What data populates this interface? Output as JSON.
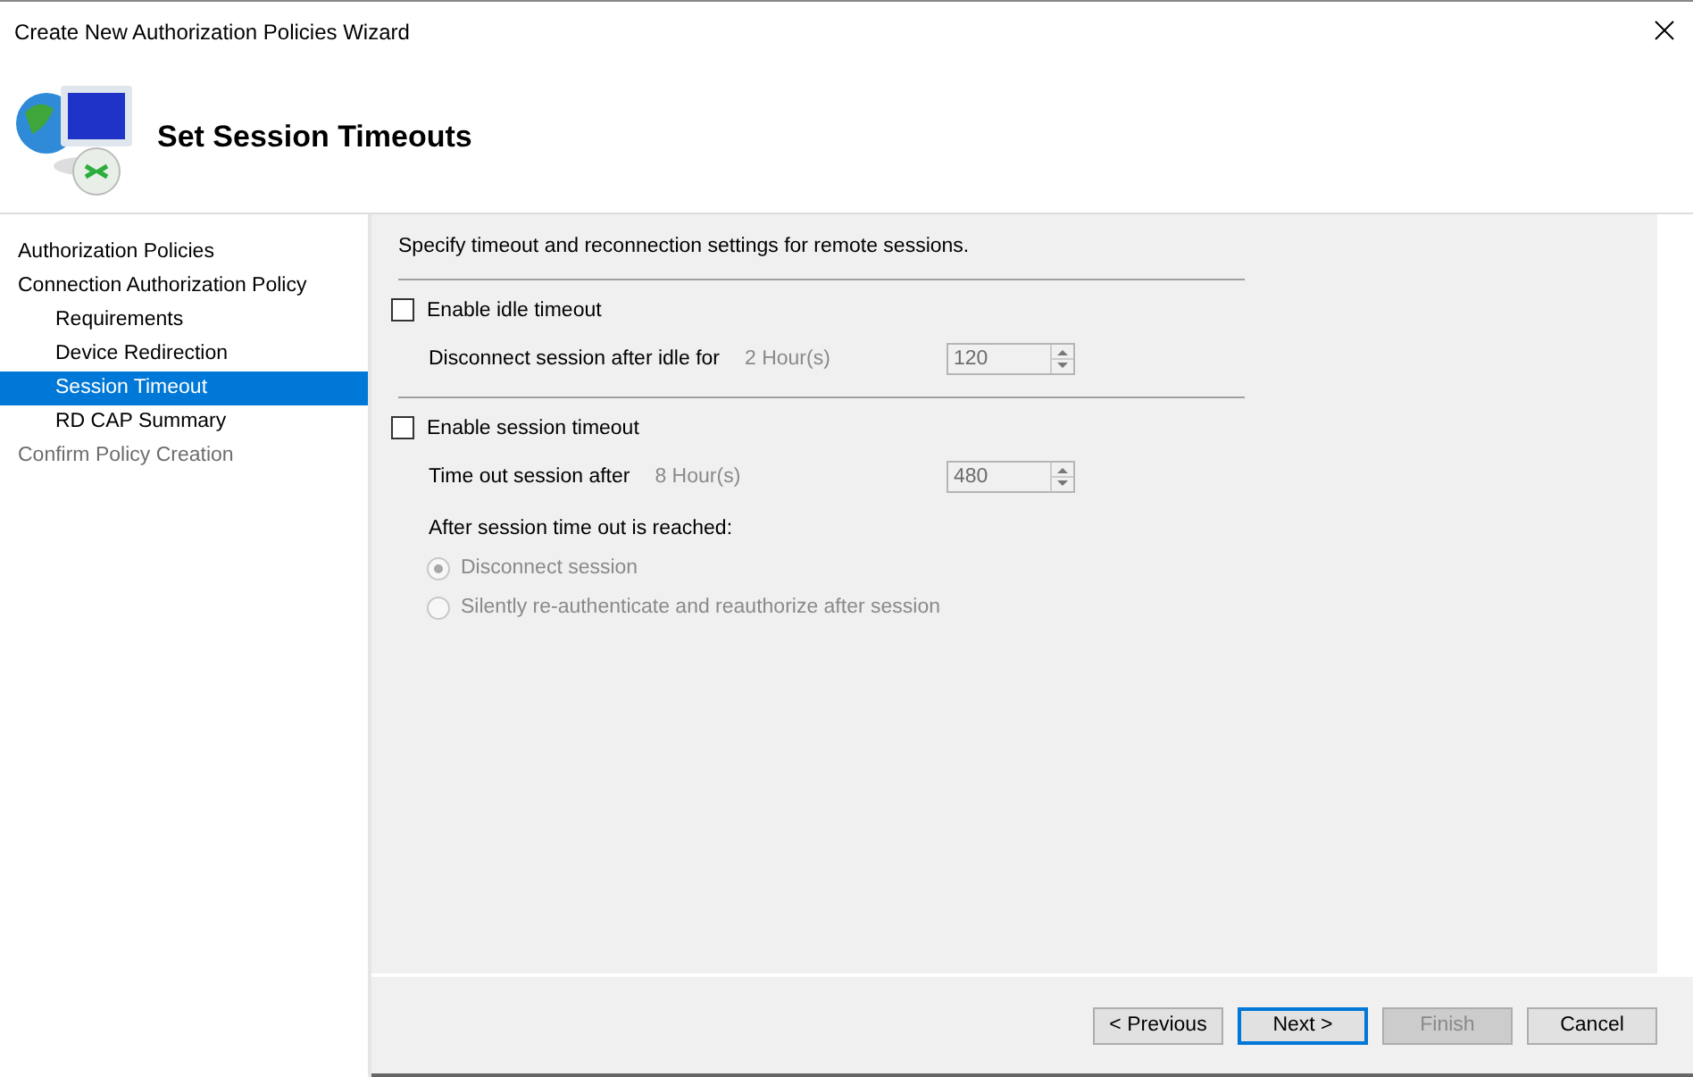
{
  "window": {
    "title": "Create New Authorization Policies Wizard"
  },
  "header": {
    "title": "Set Session Timeouts"
  },
  "sidebar": {
    "items": [
      {
        "label": "Authorization Policies",
        "selected": false,
        "disabled": false
      },
      {
        "label": "Connection Authorization Policy",
        "selected": false,
        "disabled": false,
        "children": [
          {
            "label": "Requirements",
            "selected": false,
            "disabled": false
          },
          {
            "label": "Device Redirection",
            "selected": false,
            "disabled": false
          },
          {
            "label": "Session Timeout",
            "selected": true,
            "disabled": false
          },
          {
            "label": "RD CAP Summary",
            "selected": false,
            "disabled": false
          }
        ]
      },
      {
        "label": "Confirm Policy Creation",
        "selected": false,
        "disabled": true
      }
    ]
  },
  "content": {
    "intro": "Specify timeout and reconnection settings for remote sessions.",
    "sections": [
      {
        "checkbox": {
          "label": "Enable idle timeout",
          "checked": false
        },
        "setting": {
          "label": "Disconnect session after idle for",
          "hint": "2 Hour(s)",
          "value": "120",
          "disabled": true
        }
      },
      {
        "checkbox": {
          "label": "Enable session timeout",
          "checked": false
        },
        "setting": {
          "label": "Time out session after",
          "hint": "8 Hour(s)",
          "value": "480",
          "disabled": true
        },
        "after_label": "After session time out is reached:",
        "options": [
          {
            "label": "Disconnect session",
            "selected": true,
            "disabled": true
          },
          {
            "label": "Silently re-authenticate and reauthorize after session",
            "selected": false,
            "disabled": true
          }
        ]
      }
    ]
  },
  "buttons": [
    {
      "label": "< Previous",
      "disabled": false,
      "default": false
    },
    {
      "label": "Next >",
      "disabled": false,
      "default": true
    },
    {
      "label": "Finish",
      "disabled": true,
      "default": false
    },
    {
      "label": "Cancel",
      "disabled": false,
      "default": false
    }
  ]
}
